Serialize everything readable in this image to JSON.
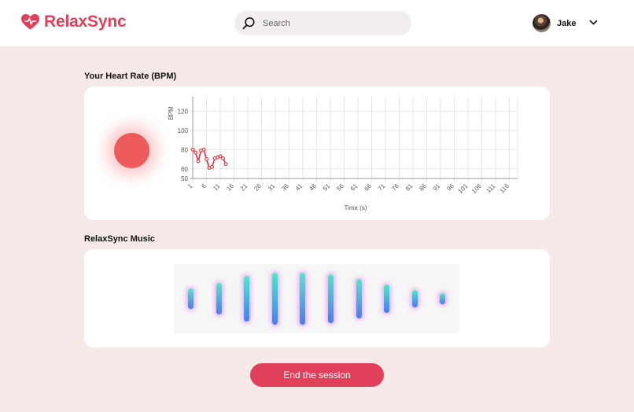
{
  "header": {
    "brand_name": "RelaxSync",
    "search_placeholder": "Search",
    "user_name": "Jake"
  },
  "heart_rate": {
    "title": "Your Heart Rate (BPM)"
  },
  "music": {
    "title": "RelaxSync Music",
    "levels": [
      0.35,
      0.55,
      0.78,
      0.88,
      0.9,
      0.85,
      0.68,
      0.48,
      0.3,
      0.18
    ]
  },
  "end_button_label": "End the session",
  "colors": {
    "brand": "#e0405a",
    "line": "#e0333a",
    "bar_top": "#4fe8c6",
    "bar_bottom": "#4a7cf0",
    "glow": "#d66ef0"
  },
  "chart_data": {
    "type": "line",
    "xlabel": "Time (s)",
    "ylabel": "BPM",
    "yticks": [
      50,
      60,
      80,
      100,
      120
    ],
    "ylim": [
      50,
      135
    ],
    "xticks": [
      "1",
      "6",
      "11",
      "16",
      "21",
      "26",
      "31",
      "36",
      "41",
      "46",
      "51",
      "56",
      "61",
      "66",
      "71",
      "76",
      "81",
      "86",
      "91",
      "96",
      "101",
      "106",
      "111",
      "116"
    ],
    "xlim": [
      1,
      119
    ],
    "grid": true,
    "series": [
      {
        "x": [
          1,
          2,
          3,
          4,
          5,
          6,
          7,
          8,
          9,
          10,
          11,
          12,
          13
        ],
        "values": [
          80,
          77,
          68,
          79,
          80,
          70,
          61,
          62,
          71,
          72,
          73,
          71,
          65
        ]
      }
    ]
  }
}
